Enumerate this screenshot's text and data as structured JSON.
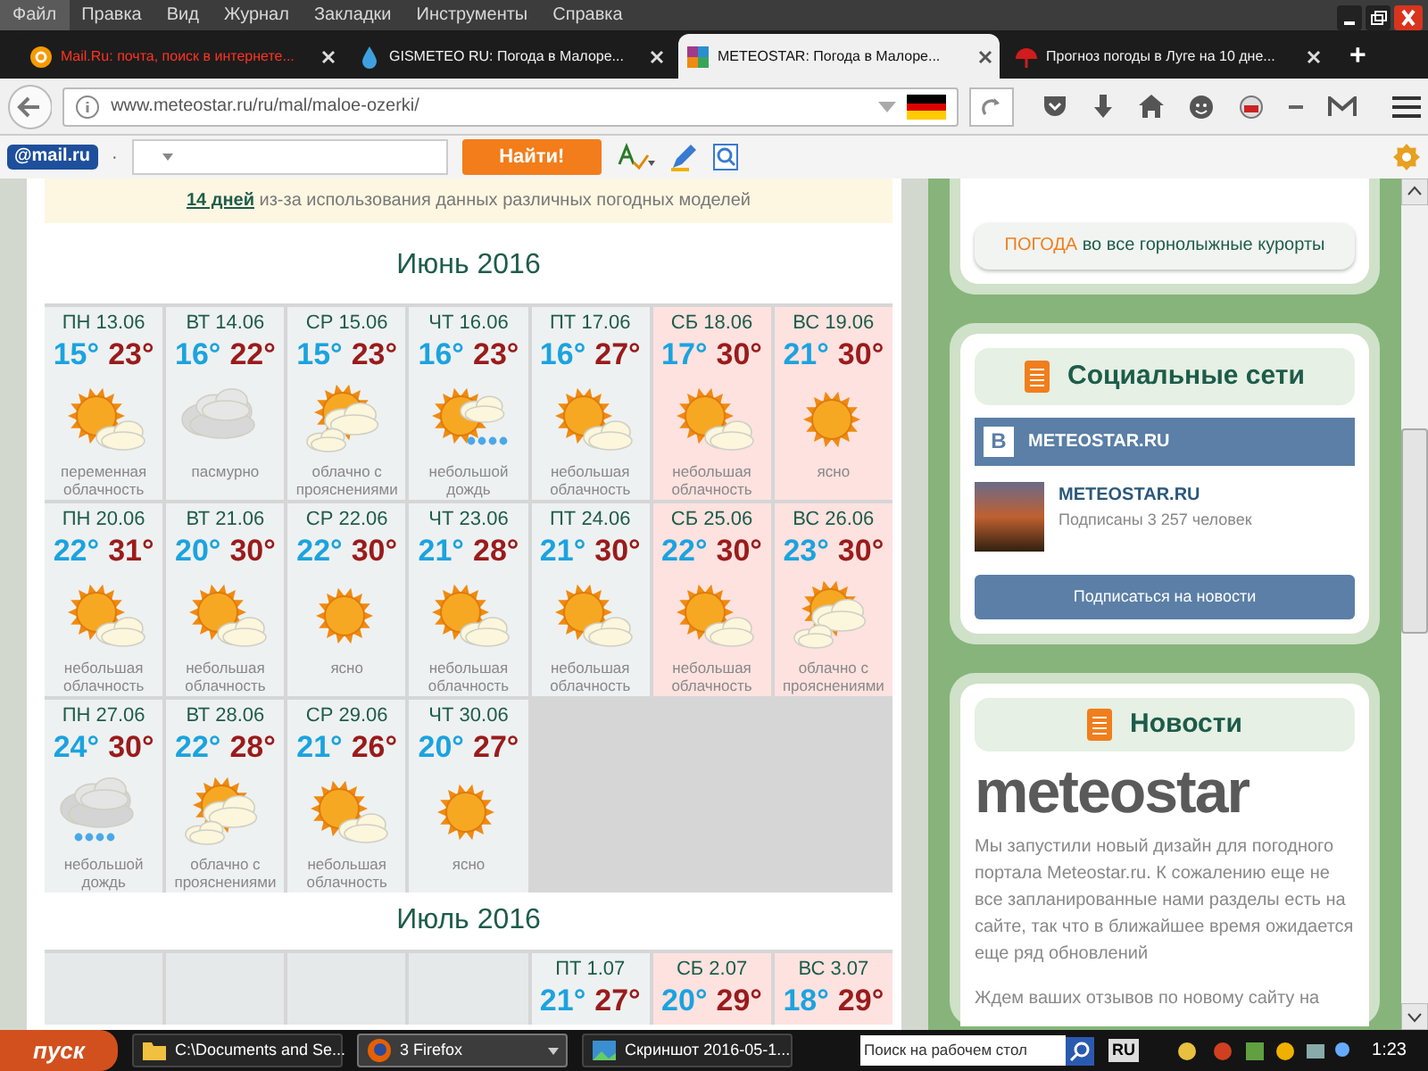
{
  "menu": [
    {
      "label": "Файл",
      "selected": true
    },
    {
      "label": "Правка",
      "selected": false
    },
    {
      "label": "Вид",
      "selected": false
    },
    {
      "label": "Журнал",
      "selected": false
    },
    {
      "label": "Закладки",
      "selected": false
    },
    {
      "label": "Инструменты",
      "selected": false
    },
    {
      "label": "Справка",
      "selected": false
    }
  ],
  "tabs": [
    {
      "title": "Mail.Ru: почта, поиск в интернете...",
      "kind": "mail",
      "selected": false,
      "highlighted": true
    },
    {
      "title": "GISMETEO RU: Погода в Малоре...",
      "kind": "drop",
      "selected": false,
      "highlighted": false
    },
    {
      "title": "METEOSTAR: Погода в Малоре...",
      "kind": "meteostar",
      "selected": true,
      "highlighted": false
    },
    {
      "title": "Прогноз погоды в Луге на 10 дне...",
      "kind": "umbrella",
      "selected": false,
      "highlighted": false
    }
  ],
  "new_tab": "+",
  "address": {
    "url": "www.meteostar.ru/ru/mal/maloe-ozerki/"
  },
  "mail_toolbar": {
    "logo": "@mail.ru",
    "separator": "·",
    "search_button": "Найти!"
  },
  "notice": {
    "link": "14 дней",
    "text": "из-за использования данных различных погодных моделей"
  },
  "months": [
    {
      "title": "Июнь 2016",
      "days": [
        {
          "kind": "day",
          "label": "ПН 13.06",
          "low": "15°",
          "high": "23°",
          "icon": {
            "kind": "few-clouds"
          },
          "description": "переменная облачность",
          "weekend": false
        },
        {
          "kind": "day",
          "label": "ВТ 14.06",
          "low": "16°",
          "high": "22°",
          "icon": {
            "kind": "overcast"
          },
          "description": "пасмурно",
          "weekend": false
        },
        {
          "kind": "day",
          "label": "СР 15.06",
          "low": "15°",
          "high": "23°",
          "icon": {
            "kind": "cloudy"
          },
          "description": "облачно с прояснениями",
          "weekend": false
        },
        {
          "kind": "day",
          "label": "ЧТ 16.06",
          "low": "16°",
          "high": "23°",
          "icon": {
            "kind": "rain-sun"
          },
          "description": "небольшой дождь",
          "weekend": false
        },
        {
          "kind": "day",
          "label": "ПТ 17.06",
          "low": "16°",
          "high": "27°",
          "icon": {
            "kind": "few-clouds"
          },
          "description": "небольшая облачность",
          "weekend": false
        },
        {
          "kind": "day",
          "label": "СБ 18.06",
          "low": "17°",
          "high": "30°",
          "icon": {
            "kind": "few-clouds"
          },
          "description": "небольшая облачность",
          "weekend": true
        },
        {
          "kind": "day",
          "label": "ВС 19.06",
          "low": "21°",
          "high": "30°",
          "icon": {
            "kind": "sun"
          },
          "description": "ясно",
          "weekend": true
        },
        {
          "kind": "day",
          "label": "ПН 20.06",
          "low": "22°",
          "high": "31°",
          "icon": {
            "kind": "few-clouds"
          },
          "description": "небольшая облачность",
          "weekend": false
        },
        {
          "kind": "day",
          "label": "ВТ 21.06",
          "low": "20°",
          "high": "30°",
          "icon": {
            "kind": "few-clouds"
          },
          "description": "небольшая облачность",
          "weekend": false
        },
        {
          "kind": "day",
          "label": "СР 22.06",
          "low": "22°",
          "high": "30°",
          "icon": {
            "kind": "sun"
          },
          "description": "ясно",
          "weekend": false
        },
        {
          "kind": "day",
          "label": "ЧТ 23.06",
          "low": "21°",
          "high": "28°",
          "icon": {
            "kind": "few-clouds"
          },
          "description": "небольшая облачность",
          "weekend": false
        },
        {
          "kind": "day",
          "label": "ПТ 24.06",
          "low": "21°",
          "high": "30°",
          "icon": {
            "kind": "few-clouds"
          },
          "description": "небольшая облачность",
          "weekend": false
        },
        {
          "kind": "day",
          "label": "СБ 25.06",
          "low": "22°",
          "high": "30°",
          "icon": {
            "kind": "few-clouds"
          },
          "description": "небольшая облачность",
          "weekend": true
        },
        {
          "kind": "day",
          "label": "ВС 26.06",
          "low": "23°",
          "high": "30°",
          "icon": {
            "kind": "cloudy"
          },
          "description": "облачно с прояснениями",
          "weekend": true
        },
        {
          "kind": "day",
          "label": "ПН 27.06",
          "low": "24°",
          "high": "30°",
          "icon": {
            "kind": "rain"
          },
          "description": "небольшой дождь",
          "weekend": false
        },
        {
          "kind": "day",
          "label": "ВТ 28.06",
          "low": "22°",
          "high": "28°",
          "icon": {
            "kind": "cloudy"
          },
          "description": "облачно с прояснениями",
          "weekend": false
        },
        {
          "kind": "day",
          "label": "СР 29.06",
          "low": "21°",
          "high": "26°",
          "icon": {
            "kind": "few-clouds"
          },
          "description": "небольшая облачность",
          "weekend": false
        },
        {
          "kind": "day",
          "label": "ЧТ 30.06",
          "low": "20°",
          "high": "27°",
          "icon": {
            "kind": "sun"
          },
          "description": "ясно",
          "weekend": false
        }
      ]
    },
    {
      "title": "Июль 2016",
      "days": [
        {
          "kind": "empty"
        },
        {
          "kind": "empty"
        },
        {
          "kind": "empty"
        },
        {
          "kind": "empty"
        },
        {
          "kind": "day",
          "label": "ПТ 1.07",
          "low": "21°",
          "high": "27°",
          "weekend": false
        },
        {
          "kind": "day",
          "label": "СБ 2.07",
          "low": "20°",
          "high": "29°",
          "weekend": true
        },
        {
          "kind": "day",
          "label": "ВС 3.07",
          "low": "18°",
          "high": "29°",
          "weekend": true
        }
      ]
    }
  ],
  "sidebar": {
    "ski_link": {
      "highlight": "ПОГОДА",
      "text": "во все горнолыжные курорты"
    },
    "social": {
      "title": "Социальные сети",
      "vk_logo": "В",
      "group": "METEOSTAR.RU",
      "name": "METEOSTAR.RU",
      "subscribers": "Подписаны 3 257 человек",
      "subscribe_button": "Подписаться на новости"
    },
    "news": {
      "title": "Новости",
      "logo": "meteostar",
      "paragraphs": [
        "Мы запустили новый дизайн для погодного портала Meteostar.ru. К сожалению еще не все запланированные нами разделы есть на сайте, так что в ближайшее время ожидается еще ряд обновлений",
        "Ждем ваших отзывов по новому сайту на"
      ]
    }
  },
  "taskbar": {
    "start": "пуск",
    "tasks": [
      {
        "label": "C:\\Documents and Se...",
        "kind": "folder",
        "selected": false
      },
      {
        "label": "3 Firefox",
        "kind": "firefox",
        "selected": true
      },
      {
        "label": "Скриншот 2016-05-1...",
        "kind": "image",
        "selected": false
      }
    ],
    "search_placeholder": "Поиск на рабочем стол",
    "language": "RU",
    "clock": "1:23"
  }
}
